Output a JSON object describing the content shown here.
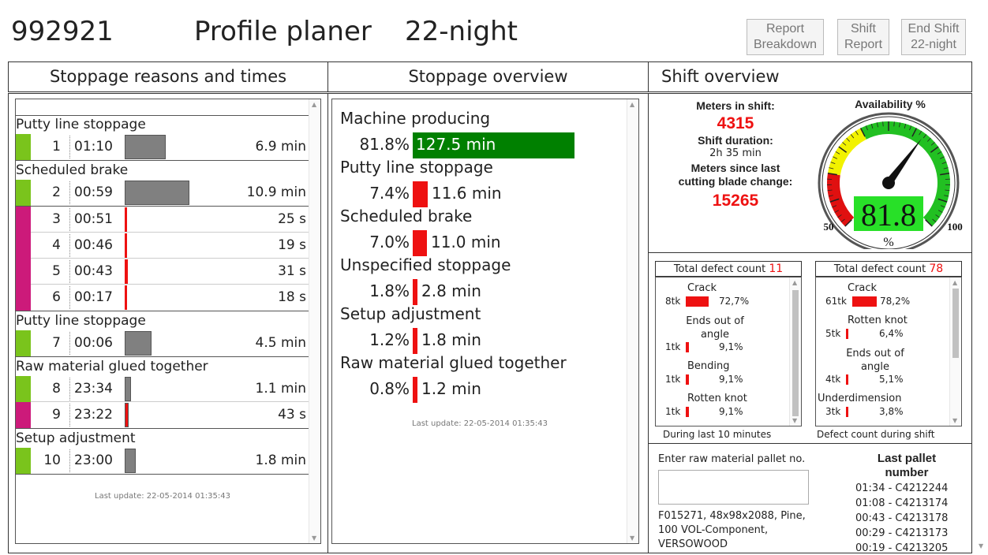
{
  "header": {
    "machine_id": "992921",
    "machine_name": "Profile planer",
    "shift": "22-night",
    "buttons": [
      {
        "line1": "Report",
        "line2": "Breakdown"
      },
      {
        "line1": "Shift",
        "line2": "Report"
      },
      {
        "line1": "End Shift",
        "line2": "22-night"
      }
    ]
  },
  "sections": {
    "left_title": "Stoppage reasons and times",
    "middle_title": "Stoppage overview",
    "right_title": "Shift overview"
  },
  "stoppage_list": {
    "groups": [
      {
        "title": "Putty line stoppage"
      },
      {
        "title": "Scheduled brake"
      },
      {
        "title": "Putty line stoppage"
      },
      {
        "title": "Raw material glued together"
      },
      {
        "title": "Setup adjustment"
      }
    ],
    "rows": [
      {
        "num": "1",
        "time": "01:10",
        "duration": "6.9 min",
        "status_color": "#7ac41c",
        "bar_color": "#808080"
      },
      {
        "num": "2",
        "time": "00:59",
        "duration": "10.9 min",
        "status_color": "#7ac41c",
        "bar_color": "#808080"
      },
      {
        "num": "3",
        "time": "00:51",
        "duration": "25 s",
        "status_color": "#cc1a7a",
        "bar_color": "#ee1111"
      },
      {
        "num": "4",
        "time": "00:46",
        "duration": "19 s",
        "status_color": "#cc1a7a",
        "bar_color": "#ee1111"
      },
      {
        "num": "5",
        "time": "00:43",
        "duration": "31 s",
        "status_color": "#cc1a7a",
        "bar_color": "#ee1111"
      },
      {
        "num": "6",
        "time": "00:17",
        "duration": "18 s",
        "status_color": "#cc1a7a",
        "bar_color": "#ee1111"
      },
      {
        "num": "7",
        "time": "00:06",
        "duration": "4.5 min",
        "status_color": "#7ac41c",
        "bar_color": "#808080"
      },
      {
        "num": "8",
        "time": "23:34",
        "duration": "1.1 min",
        "status_color": "#7ac41c",
        "bar_color": "#808080"
      },
      {
        "num": "9",
        "time": "23:22",
        "duration": "43 s",
        "status_color": "#cc1a7a",
        "bar_color": "#ee1111"
      },
      {
        "num": "10",
        "time": "23:00",
        "duration": "1.8 min",
        "status_color": "#7ac41c",
        "bar_color": "#808080"
      }
    ],
    "last_update": "Last update: 22-05-2014 01:35:43"
  },
  "overview": {
    "items": [
      {
        "label": "Machine producing",
        "pct": "81.8%",
        "value": "127.5 min",
        "bar_color": "#008000",
        "text_color": "#ffffff"
      },
      {
        "label": "Putty line stoppage",
        "pct": "7.4%",
        "value": "11.6 min",
        "bar_color": "#ee1111",
        "text_color": "#222222"
      },
      {
        "label": "Scheduled brake",
        "pct": "7.0%",
        "value": "11.0 min",
        "bar_color": "#ee1111",
        "text_color": "#222222"
      },
      {
        "label": "Unspecified stoppage",
        "pct": "1.8%",
        "value": "2.8 min",
        "bar_color": "#ee1111",
        "text_color": "#222222"
      },
      {
        "label": "Setup adjustment",
        "pct": "1.2%",
        "value": "1.8 min",
        "bar_color": "#ee1111",
        "text_color": "#222222"
      },
      {
        "label": "Raw material glued together",
        "pct": "0.8%",
        "value": "1.2 min",
        "bar_color": "#ee1111",
        "text_color": "#222222"
      }
    ],
    "last_update": "Last update: 22-05-2014 01:35:43"
  },
  "shift_overview": {
    "meters_label": "Meters in shift:",
    "meters_value": "4315",
    "duration_label": "Shift duration:",
    "duration_value": "2h 35 min",
    "blade_label_1": "Meters since last",
    "blade_label_2": "cutting blade change:",
    "blade_value": "15265",
    "availability_label": "Availability %",
    "availability_value": "81.8",
    "availability_fraction": 0.818,
    "gauge_min": "50",
    "gauge_max": "100",
    "gauge_unit": "%",
    "highlight_color": "#ee1111"
  },
  "defects_recent": {
    "header_label": "Total defect count",
    "header_count": "11",
    "footer": "During last 10 minutes",
    "items": [
      {
        "name": "Crack",
        "count": "8tk",
        "pct": "72,7%",
        "fraction": 0.727
      },
      {
        "name": "Ends out of angle",
        "count": "1tk",
        "pct": "9,1%",
        "fraction": 0.091
      },
      {
        "name": "Bending",
        "count": "1tk",
        "pct": "9,1%",
        "fraction": 0.091
      },
      {
        "name": "Rotten knot",
        "count": "1tk",
        "pct": "9,1%",
        "fraction": 0.091
      }
    ]
  },
  "defects_shift": {
    "header_label": "Total defect count",
    "header_count": "78",
    "footer": "Defect count during shift",
    "items": [
      {
        "name": "Crack",
        "count": "61tk",
        "pct": "78,2%",
        "fraction": 0.782
      },
      {
        "name": "Rotten knot",
        "count": "5tk",
        "pct": "6,4%",
        "fraction": 0.064
      },
      {
        "name": "Ends out of angle",
        "count": "4tk",
        "pct": "5,1%",
        "fraction": 0.051
      },
      {
        "name": "Underdimension",
        "count": "3tk",
        "pct": "3,8%",
        "fraction": 0.038
      }
    ]
  },
  "pallet": {
    "input_label": "Enter raw material pallet no.",
    "input_value": "",
    "info_lines": [
      "F015271, 48x98x2088, Pine,",
      "100 VOL-Component,",
      "VERSOWOOD"
    ],
    "last_title_1": "Last pallet",
    "last_title_2": "number",
    "last": [
      "01:34 - C4212244",
      "01:08 - C4213174",
      "00:43 - C4213178",
      "00:29 - C4213173",
      "00:19 - C4213205"
    ]
  }
}
